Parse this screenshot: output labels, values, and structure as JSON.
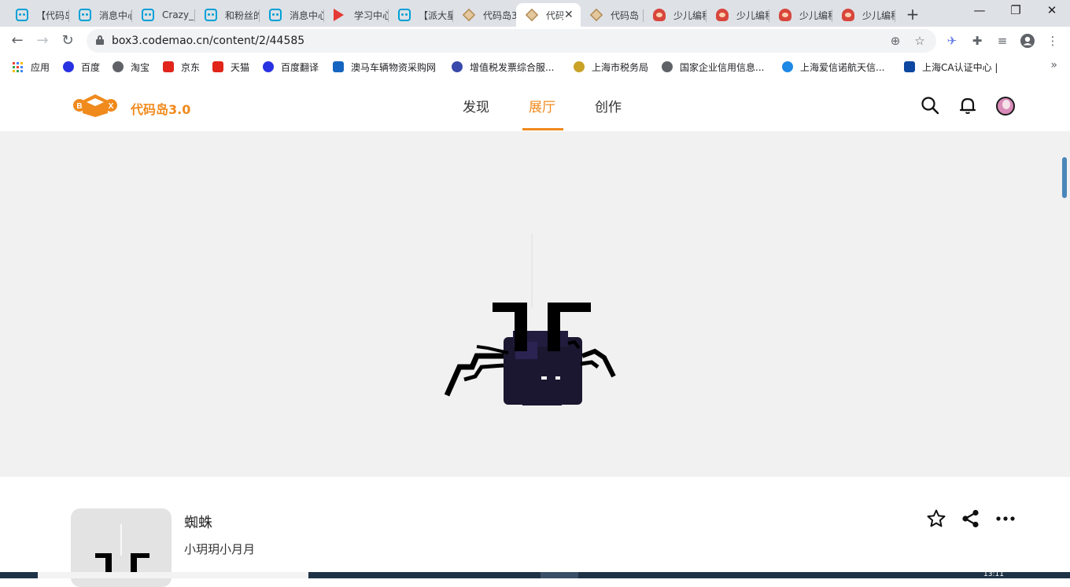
{
  "browser": {
    "tabs": [
      {
        "title": "【代码岛",
        "favicon": "bilibili-icon"
      },
      {
        "title": "消息中心",
        "favicon": "bilibili-icon"
      },
      {
        "title": "Crazy_B",
        "favicon": "bilibili-icon"
      },
      {
        "title": "和粉丝的",
        "favicon": "bilibili-icon"
      },
      {
        "title": "消息中心",
        "favicon": "bilibili-icon"
      },
      {
        "title": "学习中心",
        "favicon": "study-icon"
      },
      {
        "title": "【派大星",
        "favicon": "bilibili-icon"
      },
      {
        "title": "代码岛3",
        "favicon": "box-icon"
      },
      {
        "title": "代码",
        "favicon": "box-icon",
        "active": true
      },
      {
        "title": "代码岛",
        "favicon": "box-icon"
      },
      {
        "title": "少儿编程",
        "favicon": "kid-icon"
      },
      {
        "title": "少儿编程",
        "favicon": "kid-icon"
      },
      {
        "title": "少儿编程",
        "favicon": "kid-icon"
      },
      {
        "title": "少儿编程",
        "favicon": "kid-icon"
      }
    ],
    "close_glyph": "✕",
    "new_tab_glyph": "+",
    "window_controls": {
      "minimize": "—",
      "restore": "❐",
      "close": "✕"
    },
    "nav": {
      "back": "←",
      "forward": "→",
      "reload": "↻"
    },
    "url": "box3.codemao.cn/content/2/44585",
    "bookmarks": [
      {
        "label": "应用",
        "icon": "apps-grid-icon",
        "color": "#4285f4"
      },
      {
        "label": "百度",
        "icon": "baidu-icon",
        "color": "#2932e1"
      },
      {
        "label": "淘宝",
        "icon": "globe-icon",
        "color": "#5f6368"
      },
      {
        "label": "京东",
        "icon": "jd-icon",
        "color": "#e1251b"
      },
      {
        "label": "天猫",
        "icon": "tmall-icon",
        "color": "#e1251b"
      },
      {
        "label": "百度翻译",
        "icon": "baidu-icon",
        "color": "#2932e1"
      },
      {
        "label": "澳马车辆物资采购网",
        "icon": "ap-icon",
        "color": "#1565c0"
      },
      {
        "label": "增值税发票综合服...",
        "icon": "tax-icon",
        "color": "#3949ab"
      },
      {
        "label": "上海市税务局",
        "icon": "shield-icon",
        "color": "#c9a227"
      },
      {
        "label": "国家企业信用信息...",
        "icon": "globe-icon",
        "color": "#5f6368"
      },
      {
        "label": "上海爱信诺航天信...",
        "icon": "ie-icon",
        "color": "#1e88e5"
      },
      {
        "label": "上海CA认证中心 |",
        "icon": "ca-icon",
        "color": "#0d47a1"
      }
    ],
    "more_glyph": "»"
  },
  "site": {
    "logo_badge": "BX",
    "logo_text": "代码岛3.0",
    "nav": [
      "发现",
      "展厅",
      "创作"
    ],
    "active_nav_index": 1,
    "accent_color": "#f08a1d"
  },
  "project": {
    "title": "蜘蛛",
    "author": "小玥玥小月月"
  },
  "taskbar": {
    "clock_fragment": "13:11"
  }
}
